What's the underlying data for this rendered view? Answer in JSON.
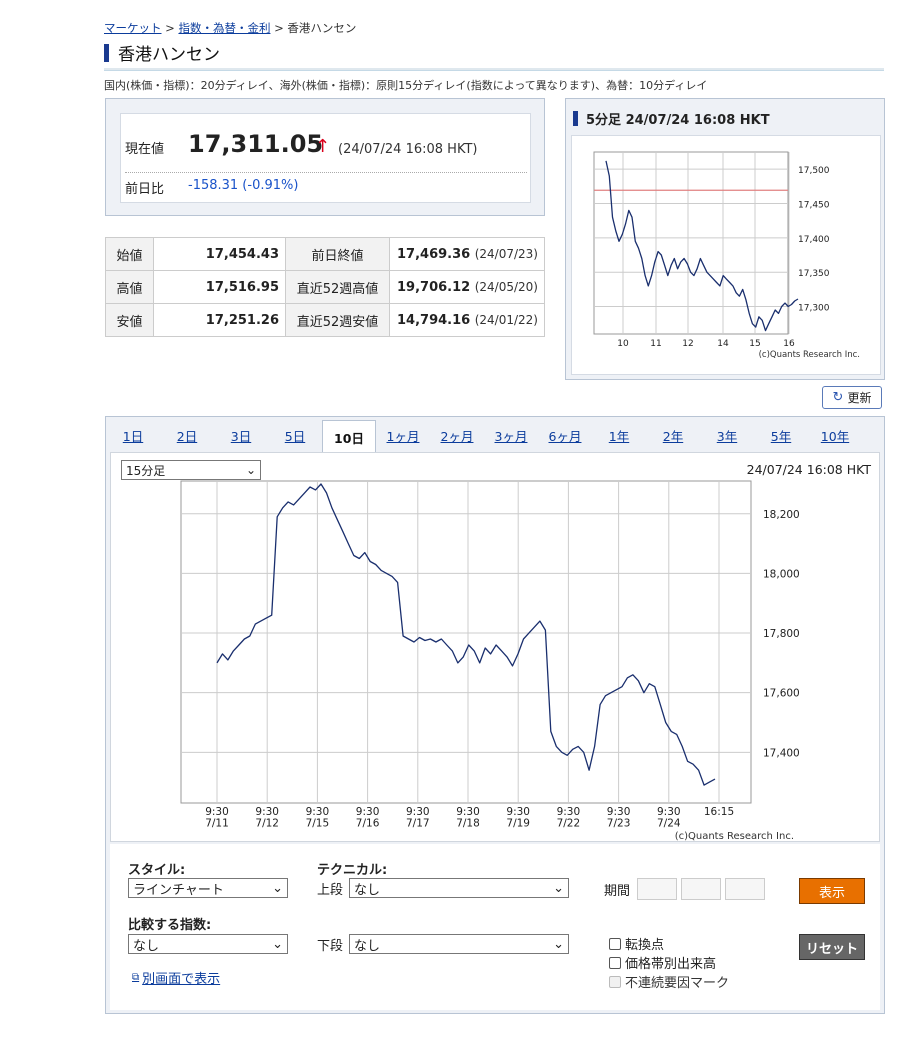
{
  "breadcrumb": {
    "items": [
      "マーケット",
      "指数・為替・金利"
    ],
    "current": "香港ハンセン",
    "sep": ">"
  },
  "title": "香港ハンセン",
  "delay_note": "国内(株価・指標)：20分ディレイ、海外(株価・指標)：原則15分ディレイ(指数によって異なります)、為替：10分ディレイ",
  "price": {
    "label": "現在値",
    "value": "17,311.05",
    "arrow": "↑",
    "time": "(24/07/24 16:08 HKT)",
    "diff_label": "前日比",
    "diff": "-158.31 (-0.91%)"
  },
  "stats": [
    {
      "l1": "始値",
      "v1": "17,454.43",
      "l2": "前日終値",
      "v2": "17,469.36",
      "d2": "(24/07/23)"
    },
    {
      "l1": "高値",
      "v1": "17,516.95",
      "l2": "直近52週高値",
      "v2": "19,706.12",
      "d2": "(24/05/20)"
    },
    {
      "l1": "安値",
      "v1": "17,251.26",
      "l2": "直近52週安値",
      "v2": "14,794.16",
      "d2": "(24/01/22)"
    }
  ],
  "refresh_label": "更新",
  "tabs": [
    "1日",
    "2日",
    "3日",
    "5日",
    "10日",
    "1ヶ月",
    "2ヶ月",
    "3ヶ月",
    "6ヶ月",
    "1年",
    "2年",
    "3年",
    "5年",
    "10年"
  ],
  "active_tab": 4,
  "interval": "15分足",
  "chart_time": "24/07/24 16:08 HKT",
  "controls": {
    "style_label": "スタイル:",
    "style_value": "ラインチャート",
    "tech_label": "テクニカル:",
    "upper_label": "上段",
    "upper_value": "なし",
    "lower_label": "下段",
    "lower_value": "なし",
    "period_label": "期間",
    "compare_label": "比較する指数:",
    "compare_value": "なし",
    "show_button": "表示",
    "reset_button": "リセット",
    "checkbox_1": "転換点",
    "checkbox_2": "価格帯別出来高",
    "checkbox_3": "不連続要因マーク",
    "new_window": "別画面で表示"
  },
  "chart_data": [
    {
      "type": "line",
      "title": "5分足 24/07/24 16:08 HKT",
      "credit": "(c)Quants Research Inc.",
      "x_ticks": [
        "10",
        "11",
        "12",
        "14",
        "15",
        "16"
      ],
      "y_ticks": [
        17500,
        17450,
        17400,
        17350,
        17300
      ],
      "y_tick_labels": [
        "17,500",
        "17,450",
        "17,400",
        "17,350",
        "17,300"
      ],
      "ylim": [
        17260,
        17525
      ],
      "prev_close": 17469.36,
      "line_color": "#1a2f6e",
      "ref_color": "#e08080",
      "series": [
        {
          "values": [
            17512,
            17490,
            17430,
            17410,
            17395,
            17405,
            17420,
            17440,
            17430,
            17395,
            17385,
            17370,
            17345,
            17330,
            17345,
            17365,
            17380,
            17375,
            17360,
            17345,
            17360,
            17370,
            17355,
            17365,
            17370,
            17362,
            17350,
            17345,
            17355,
            17370,
            17360,
            17350,
            17345,
            17340,
            17335,
            17330,
            17345,
            17340,
            17335,
            17330,
            17320,
            17315,
            17325,
            17310,
            17290,
            17275,
            17270,
            17285,
            17280,
            17265,
            17275,
            17285,
            17295,
            17290,
            17300,
            17305,
            17300,
            17303,
            17308,
            17311
          ]
        }
      ]
    },
    {
      "type": "line",
      "credit": "(c)Quants Research Inc.",
      "x_ticks": [
        "9:30\n7/11",
        "9:30\n7/12",
        "9:30\n7/15",
        "9:30\n7/16",
        "9:30\n7/17",
        "9:30\n7/18",
        "9:30\n7/19",
        "9:30\n7/22",
        "9:30\n7/23",
        "9:30\n7/24",
        "16:15"
      ],
      "y_ticks": [
        18200,
        18000,
        17800,
        17600,
        17400
      ],
      "y_tick_labels": [
        "18,200",
        "18,000",
        "17,800",
        "17,600",
        "17,400"
      ],
      "ylim": [
        17230,
        18310
      ],
      "line_color": "#1a2f6e",
      "series": [
        {
          "values": [
            17700,
            17730,
            17710,
            17740,
            17760,
            17780,
            17790,
            17830,
            17840,
            17850,
            17860,
            18190,
            18220,
            18240,
            18230,
            18250,
            18270,
            18290,
            18280,
            18300,
            18270,
            18220,
            18180,
            18140,
            18100,
            18060,
            18050,
            18070,
            18040,
            18030,
            18010,
            18000,
            17990,
            17970,
            17790,
            17780,
            17770,
            17785,
            17775,
            17780,
            17770,
            17780,
            17760,
            17740,
            17700,
            17720,
            17760,
            17740,
            17700,
            17750,
            17730,
            17760,
            17740,
            17720,
            17690,
            17730,
            17780,
            17800,
            17820,
            17840,
            17810,
            17470,
            17420,
            17400,
            17390,
            17410,
            17420,
            17400,
            17340,
            17420,
            17560,
            17590,
            17600,
            17610,
            17620,
            17650,
            17660,
            17640,
            17600,
            17630,
            17620,
            17560,
            17500,
            17470,
            17460,
            17420,
            17370,
            17360,
            17340,
            17290,
            17300,
            17310
          ]
        }
      ]
    }
  ]
}
